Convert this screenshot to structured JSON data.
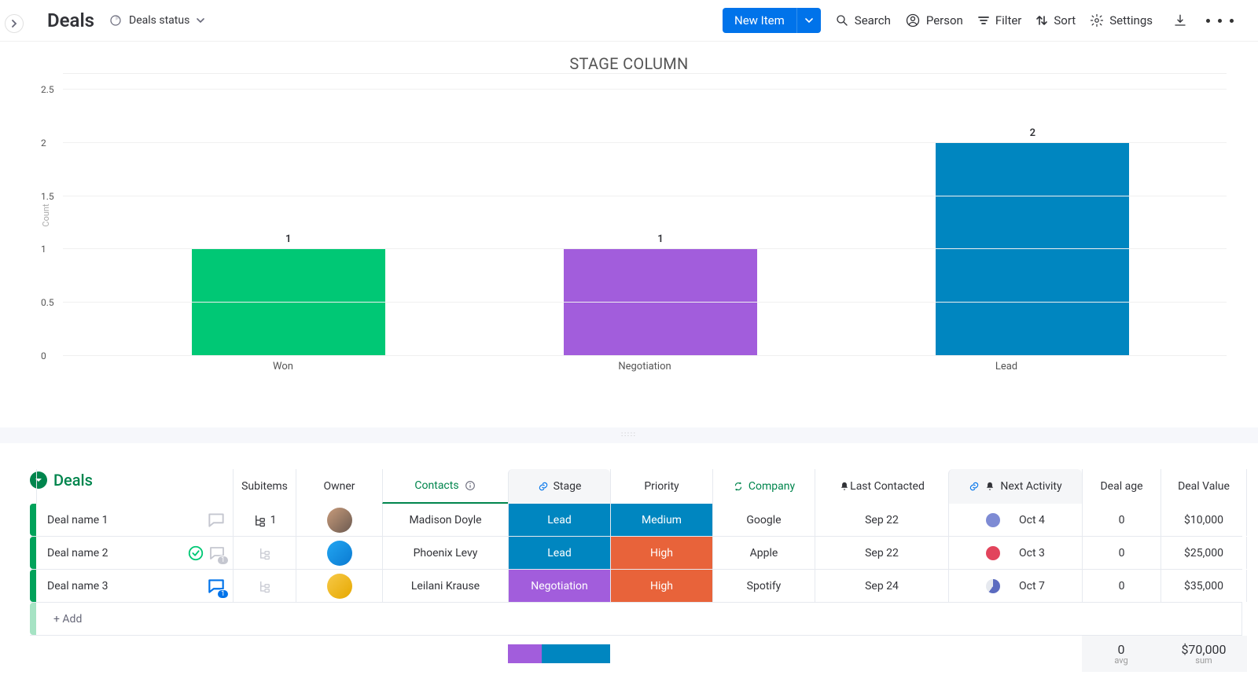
{
  "header": {
    "title": "Deals",
    "view": "Deals status",
    "new_item": "New Item",
    "toolbar": {
      "search": "Search",
      "person": "Person",
      "filter": "Filter",
      "sort": "Sort",
      "settings": "Settings"
    }
  },
  "chart_data": {
    "type": "bar",
    "title": "STAGE COLUMN",
    "ylabel": "Count",
    "ylim": [
      0,
      2.5
    ],
    "yticks": [
      0,
      0.5,
      1,
      1.5,
      2,
      2.5
    ],
    "categories": [
      "Won",
      "Negotiation",
      "Lead"
    ],
    "values": [
      1,
      1,
      2
    ],
    "colors": [
      "#00c875",
      "#a25ddc",
      "#0086c0"
    ]
  },
  "group": {
    "name": "Deals",
    "columns": {
      "subitems": "Subitems",
      "owner": "Owner",
      "contacts": "Contacts",
      "stage": "Stage",
      "priority": "Priority",
      "company": "Company",
      "last_contacted": "Last Contacted",
      "next_activity": "Next Activity",
      "deal_age": "Deal age",
      "deal_value": "Deal Value"
    },
    "rows": [
      {
        "name": "Deal name 1",
        "subitems": "1",
        "owner_color": "linear-gradient(135deg,#c89b7b,#6b5a50)",
        "contact": "Madison Doyle",
        "stage": "Lead",
        "stage_class": "pill-lead",
        "priority": "Medium",
        "prio_class": "pill-med",
        "company": "Google",
        "last": "Sep 22",
        "status_color": "#7e8bd4",
        "next": "Oct 4",
        "age": "0",
        "value": "$10,000"
      },
      {
        "name": "Deal name 2",
        "subitems": "",
        "owner_color": "linear-gradient(135deg,#22a6f2,#0b7ad1)",
        "contact": "Phoenix Levy",
        "stage": "Lead",
        "stage_class": "pill-lead",
        "priority": "High",
        "prio_class": "pill-high",
        "company": "Apple",
        "last": "Sep 22",
        "status_color": "#e2445c",
        "next": "Oct 3",
        "age": "0",
        "value": "$25,000"
      },
      {
        "name": "Deal name 3",
        "subitems": "",
        "owner_color": "linear-gradient(135deg,#f7c948,#e6a800)",
        "contact": "Leilani Krause",
        "stage": "Negotiation",
        "stage_class": "pill-neg",
        "priority": "High",
        "prio_class": "pill-high",
        "company": "Spotify",
        "last": "Sep 24",
        "status_color": "#5b6bc0",
        "next": "Oct 7",
        "age": "0",
        "value": "$35,000"
      }
    ],
    "add_row": "+ Add",
    "summary": {
      "stage_segments": [
        {
          "color": "#a25ddc",
          "pct": 33.3
        },
        {
          "color": "#0086c0",
          "pct": 66.7
        }
      ],
      "age_avg": "0",
      "age_lbl": "avg",
      "value_sum": "$70,000",
      "value_lbl": "sum"
    }
  }
}
